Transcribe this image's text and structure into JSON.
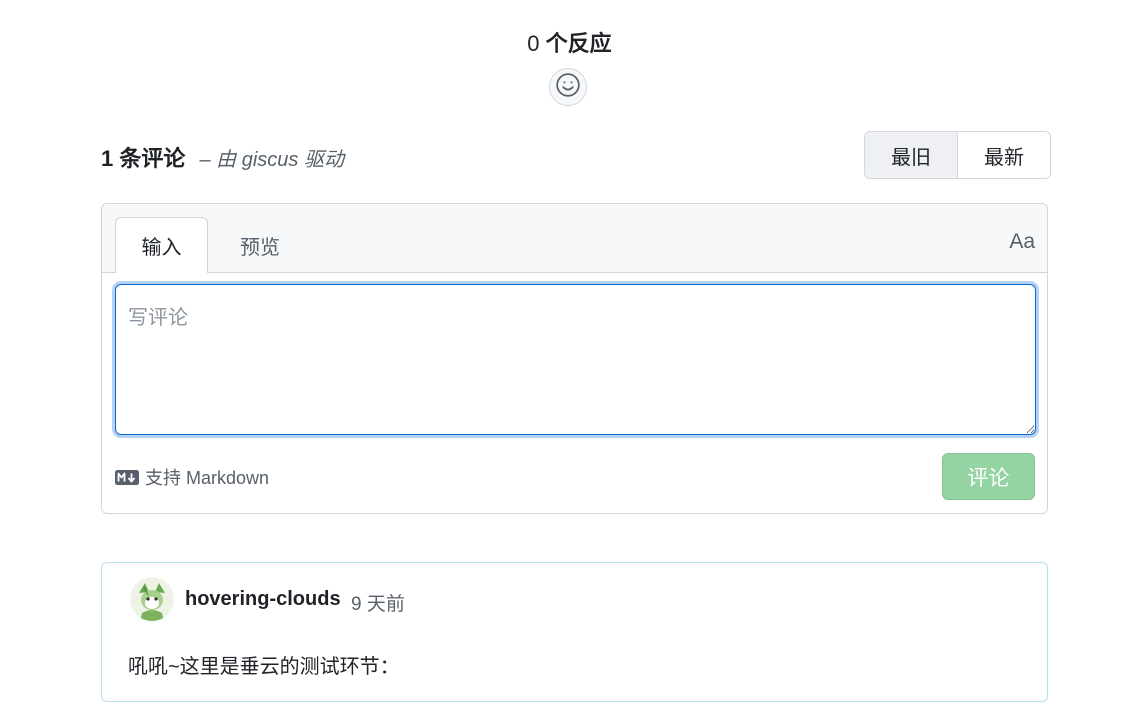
{
  "reactions": {
    "count": "0",
    "label": "个反应",
    "add_icon": "smiley-icon"
  },
  "comments_header": {
    "count_label": "1 条评论",
    "powered_by": "– 由 giscus 驱动"
  },
  "sort": {
    "oldest": "最旧",
    "newest": "最新",
    "selected": "最旧"
  },
  "editor": {
    "tabs": [
      "输入",
      "预览"
    ],
    "active_tab": "输入",
    "format_toggle": "Aa",
    "placeholder": "写评论",
    "value": "",
    "markdown_hint": "支持 Markdown",
    "markdown_icon": "markdown-icon",
    "submit_label": "评论"
  },
  "comment": {
    "author": "hovering-clouds",
    "time": "9 天前",
    "body": "吼吼~这里是垂云的测试环节："
  }
}
